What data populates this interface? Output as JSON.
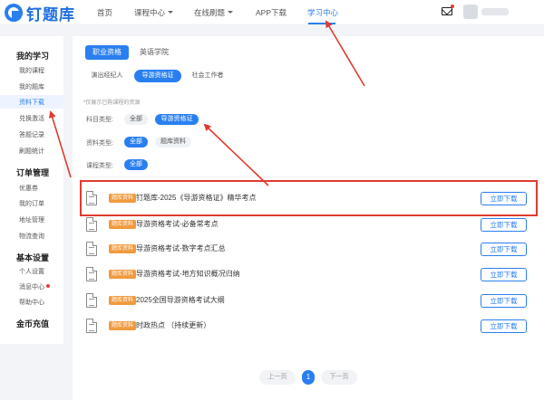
{
  "header": {
    "logo_text": "钉题库",
    "nav": [
      {
        "label": "首页"
      },
      {
        "label": "课程中心"
      },
      {
        "label": "在线刷题"
      },
      {
        "label": "APP下载"
      },
      {
        "label": "学习中心"
      }
    ]
  },
  "sidebar": {
    "sections": [
      {
        "title": "我的学习",
        "items": [
          "我的课程",
          "我的题库",
          "资料下载",
          "兑换激活",
          "答题记录",
          "刷题统计"
        ]
      },
      {
        "title": "订单管理",
        "items": [
          "优惠券",
          "我的订单",
          "地址管理",
          "物流查询"
        ]
      },
      {
        "title": "基本设置",
        "items": [
          "个人设置",
          "消息中心",
          "帮助中心"
        ]
      },
      {
        "title": "金币充值",
        "items": []
      }
    ],
    "active_item": "资料下载"
  },
  "main": {
    "tabs": [
      "职业资格",
      "英语学院"
    ],
    "active_tab": "职业资格",
    "subtabs": [
      "演出经纪人",
      "导游资格证",
      "社会工作者"
    ],
    "active_subtab": "导游资格证",
    "hint": "*仅展示已购课程的资源",
    "filters": {
      "subject_label": "科目类型:",
      "subject_options": [
        "全部",
        "导游资格证"
      ],
      "material_label": "资料类型:",
      "material_options": [
        "全部",
        "题库资料"
      ],
      "course_label": "课程类型:",
      "course_options": [
        "全部"
      ]
    },
    "items": [
      {
        "badge": "题库资料",
        "title": "钉题库-2025《导游资格证》精华考点",
        "button": "立即下载"
      },
      {
        "badge": "题库资料",
        "title": "导游资格考试-必备常考点",
        "button": "立即下载"
      },
      {
        "badge": "题库资料",
        "title": "导游资格考试-数字考点汇总",
        "button": "立即下载"
      },
      {
        "badge": "题库资料",
        "title": "导游资格考试-地方知识概况归纳",
        "button": "立即下载"
      },
      {
        "badge": "题库资料",
        "title": "2025全国导游资格考试大纲",
        "button": "立即下载"
      },
      {
        "badge": "题库资料",
        "title": "时政热点 （持续更新）",
        "button": "立即下载"
      }
    ],
    "pagination": {
      "prev": "上一页",
      "current": "1",
      "next": "下一页"
    }
  },
  "colors": {
    "accent": "#2a7ff0",
    "badge": "#f19a3e",
    "annotation": "#e03b30"
  }
}
